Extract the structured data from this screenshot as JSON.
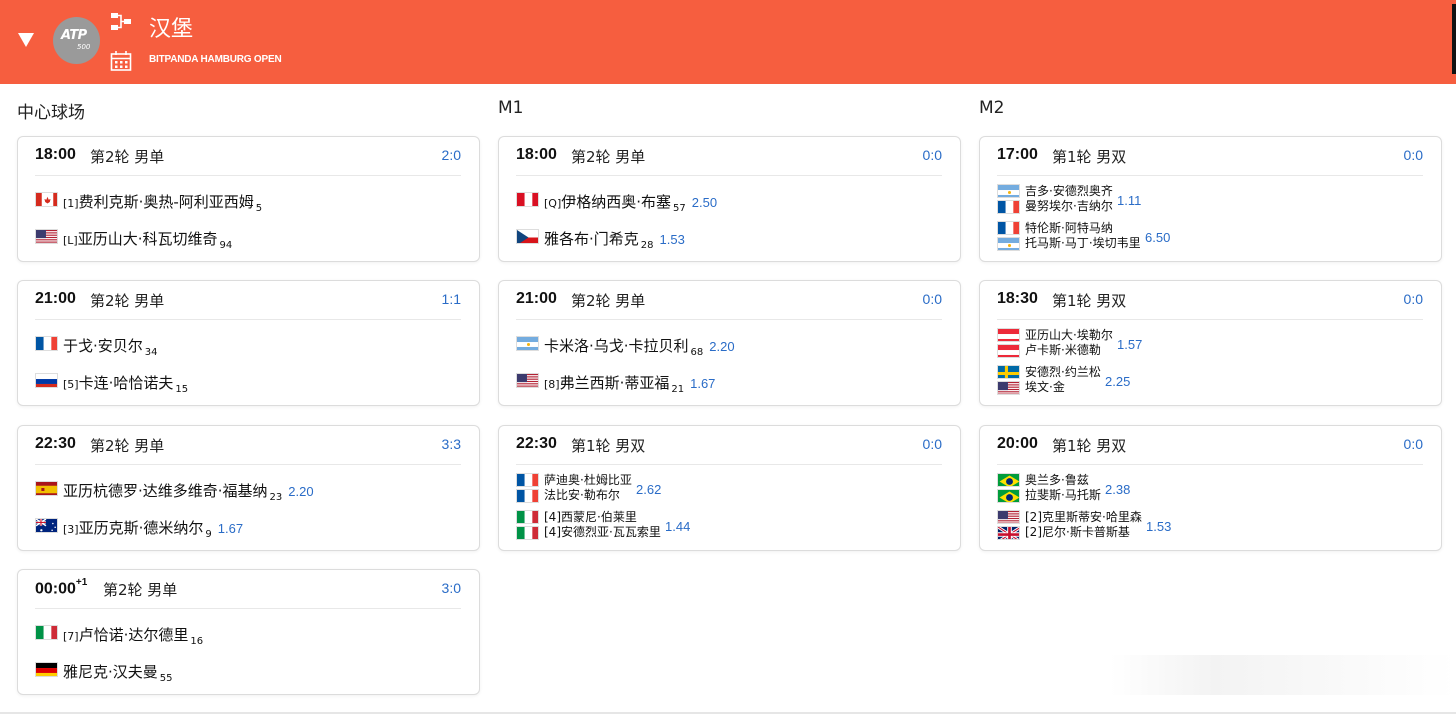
{
  "tournament": {
    "title": "汉堡",
    "subtitle": "BITPANDA HAMBURG OPEN",
    "logo_text": "ATP",
    "logo_level": "500",
    "accent_color": "#f65e3f"
  },
  "courts": [
    {
      "name": "中心球场",
      "matches": [
        {
          "time": "18:00",
          "time_sup": "",
          "round": "第2轮 男单",
          "score": "2:0",
          "p1": {
            "flag": "canada",
            "seed": "[1]",
            "name": "费利克斯·奥热-阿利亚西姆",
            "rank": "5",
            "odds": ""
          },
          "p2": {
            "flag": "usa",
            "seed": "[L]",
            "name": "亚历山大·科瓦切维奇",
            "rank": "94",
            "odds": ""
          }
        },
        {
          "time": "21:00",
          "time_sup": "",
          "round": "第2轮 男单",
          "score": "1:1",
          "p1": {
            "flag": "france",
            "seed": "",
            "name": "于戈·安贝尔",
            "rank": "34",
            "odds": ""
          },
          "p2": {
            "flag": "russia",
            "seed": "[5]",
            "name": "卡连·哈恰诺夫",
            "rank": "15",
            "odds": ""
          }
        },
        {
          "time": "22:30",
          "time_sup": "",
          "round": "第2轮 男单",
          "score": "3:3",
          "p1": {
            "flag": "spain",
            "seed": "",
            "name": "亚历杭德罗·达维多维奇·福基纳",
            "rank": "23",
            "odds": "2.20"
          },
          "p2": {
            "flag": "australia",
            "seed": "[3]",
            "name": "亚历克斯·德米纳尔",
            "rank": "9",
            "odds": "1.67"
          }
        },
        {
          "time": "00:00",
          "time_sup": "+1",
          "round": "第2轮 男单",
          "score": "3:0",
          "p1": {
            "flag": "italy",
            "seed": "[7]",
            "name": "卢恰诺·达尔德里",
            "rank": "16",
            "odds": ""
          },
          "p2": {
            "flag": "germany",
            "seed": "",
            "name": "雅尼克·汉夫曼",
            "rank": "55",
            "odds": ""
          }
        }
      ]
    },
    {
      "name": "M1",
      "matches": [
        {
          "time": "18:00",
          "time_sup": "",
          "round": "第2轮 男单",
          "score": "0:0",
          "p1": {
            "flag": "peru",
            "seed": "[Q]",
            "name": "伊格纳西奥·布塞",
            "rank": "57",
            "odds": "2.50"
          },
          "p2": {
            "flag": "czech",
            "seed": "",
            "name": "雅各布·门希克",
            "rank": "28",
            "odds": "1.53"
          }
        },
        {
          "time": "21:00",
          "time_sup": "",
          "round": "第2轮 男单",
          "score": "0:0",
          "p1": {
            "flag": "argentina",
            "seed": "",
            "name": "卡米洛·乌戈·卡拉贝利",
            "rank": "68",
            "odds": "2.20"
          },
          "p2": {
            "flag": "usa",
            "seed": "[8]",
            "name": "弗兰西斯·蒂亚福",
            "rank": "21",
            "odds": "1.67"
          }
        },
        {
          "time": "22:30",
          "time_sup": "",
          "round": "第1轮 男双",
          "score": "0:0",
          "d1": {
            "flags": [
              "france",
              "france"
            ],
            "names": [
              "萨迪奥·杜姆比亚",
              "法比安·勒布尔"
            ],
            "odds": "2.62"
          },
          "d2": {
            "flags": [
              "italy",
              "italy"
            ],
            "names": [
              "[4]西蒙尼·伯莱里",
              "[4]安德烈亚·瓦瓦索里"
            ],
            "odds": "1.44"
          }
        }
      ]
    },
    {
      "name": "M2",
      "matches": [
        {
          "time": "17:00",
          "time_sup": "",
          "round": "第1轮 男双",
          "score": "0:0",
          "d1": {
            "flags": [
              "argentina",
              "france"
            ],
            "names": [
              "吉多·安德烈奥齐",
              "曼努埃尔·吉纳尔"
            ],
            "odds": "1.11"
          },
          "d2": {
            "flags": [
              "france",
              "argentina"
            ],
            "names": [
              "特伦斯·阿特马纳",
              "托马斯·马丁·埃切韦里"
            ],
            "odds": "6.50"
          }
        },
        {
          "time": "18:30",
          "time_sup": "",
          "round": "第1轮 男双",
          "score": "0:0",
          "d1": {
            "flags": [
              "austria",
              "austria"
            ],
            "names": [
              "亚历山大·埃勒尔",
              "卢卡斯·米德勒"
            ],
            "odds": "1.57"
          },
          "d2": {
            "flags": [
              "sweden",
              "usa"
            ],
            "names": [
              "安德烈·约兰松",
              "埃文·金"
            ],
            "odds": "2.25"
          }
        },
        {
          "time": "20:00",
          "time_sup": "",
          "round": "第1轮 男双",
          "score": "0:0",
          "d1": {
            "flags": [
              "brazil",
              "brazil"
            ],
            "names": [
              "奥兰多·鲁兹",
              "拉斐斯·马托斯"
            ],
            "odds": "2.38"
          },
          "d2": {
            "flags": [
              "usa",
              "uk"
            ],
            "names": [
              "[2]克里斯蒂安·哈里森",
              "[2]尼尔·斯卡普斯基"
            ],
            "odds": "1.53"
          }
        }
      ]
    }
  ]
}
